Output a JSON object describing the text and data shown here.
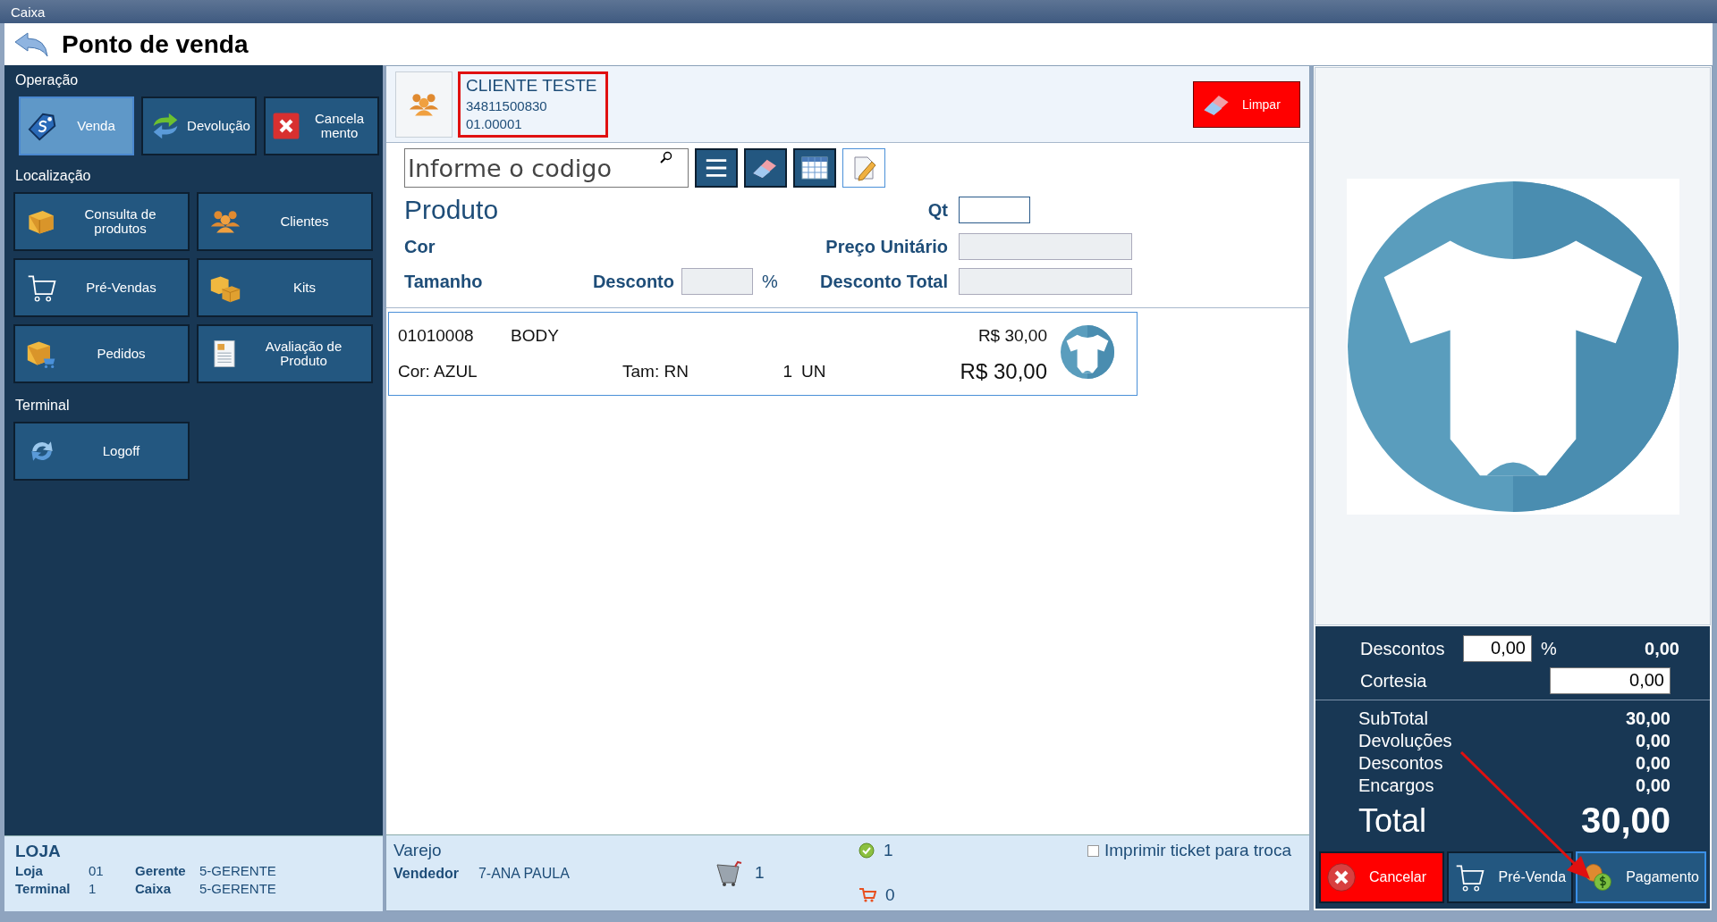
{
  "window": {
    "title": "Caixa"
  },
  "header": {
    "title": "Ponto de venda"
  },
  "sidebar": {
    "sections": [
      {
        "label": "Operação",
        "kind": "row",
        "buttons": [
          {
            "label": "Venda",
            "kind": "sale",
            "selected": true
          },
          {
            "label": "Devolução",
            "kind": "return",
            "selected": false
          },
          {
            "label": "Cancela mento",
            "kind": "cancel",
            "selected": false
          }
        ]
      },
      {
        "label": "Localização",
        "kind": "grid",
        "buttons": [
          {
            "label": "Consulta de produtos",
            "kind": "box",
            "selected": false
          },
          {
            "label": "Clientes",
            "kind": "people",
            "selected": false
          },
          {
            "label": "Pré-Vendas",
            "kind": "cart",
            "selected": false
          },
          {
            "label": "Kits",
            "kind": "boxes",
            "selected": false
          },
          {
            "label": "Pedidos",
            "kind": "order",
            "selected": false
          },
          {
            "label": "Avaliação de Produto",
            "kind": "document",
            "selected": false
          }
        ]
      },
      {
        "label": "Terminal",
        "kind": "grid",
        "buttons": [
          {
            "label": "Logoff",
            "kind": "refresh",
            "selected": false
          }
        ]
      }
    ]
  },
  "store_info": {
    "title": "LOJA",
    "fields": [
      {
        "label": "Loja",
        "value": "01"
      },
      {
        "label": "Gerente",
        "value": "5-GERENTE"
      },
      {
        "label": "Terminal",
        "value": "1"
      },
      {
        "label": "Caixa",
        "value": "5-GERENTE"
      }
    ]
  },
  "client": {
    "name": "CLIENTE TESTE",
    "document": "34811500830",
    "code": "01.00001",
    "highlighted": true
  },
  "clear_button": {
    "label": "Limpar"
  },
  "search": {
    "placeholder": "Informe o codigo"
  },
  "product_form": {
    "title": "Produto",
    "qt_label": "Qt",
    "color_label": "Cor",
    "unit_price_label": "Preço Unitário",
    "size_label": "Tamanho",
    "discount_label": "Desconto",
    "percent": "%",
    "total_discount_label": "Desconto Total"
  },
  "items": [
    {
      "code": "01010008",
      "name": "BODY",
      "unit_price": "R$ 30,00",
      "color_text": "Cor: AZUL",
      "size": "Tam: RN",
      "qty": "1",
      "unit": "UN",
      "total": "R$ 30,00"
    }
  ],
  "sale_info": {
    "type": "Varejo",
    "seller_label": "Vendedor",
    "seller": "7-ANA PAULA",
    "cart_count": "1",
    "ok_count": "1",
    "pending_count": "0"
  },
  "print_ticket": {
    "label": "Imprimir ticket para troca",
    "checked": false
  },
  "totals": {
    "discount_label": "Descontos",
    "discount_percent": "0,00",
    "percent": "%",
    "discount_value": "0,00",
    "courtesy_label": "Cortesia",
    "courtesy": "0,00",
    "rows": [
      {
        "label": "SubTotal",
        "value": "30,00"
      },
      {
        "label": "Devoluções",
        "value": "0,00"
      },
      {
        "label": "Descontos",
        "value": "0,00"
      },
      {
        "label": "Encargos",
        "value": "0,00"
      }
    ],
    "total_label": "Total",
    "total": "30,00"
  },
  "actions": [
    {
      "label": "Cancelar",
      "kind": "cancel",
      "selected": false
    },
    {
      "label": "Pré-Venda",
      "kind": "cart",
      "selected": false
    },
    {
      "label": "Pagamento",
      "kind": "payment",
      "selected": true
    }
  ],
  "annotation": {
    "arrow": true
  }
}
